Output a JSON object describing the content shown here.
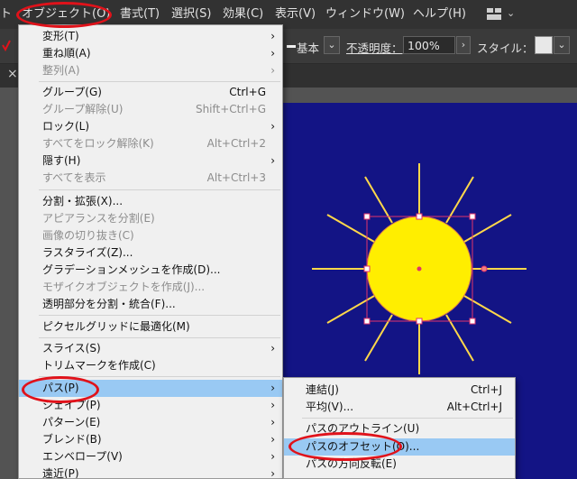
{
  "menubar": {
    "partial": "ト",
    "items": [
      "オブジェクト(O)",
      "書式(T)",
      "選択(S)",
      "効果(C)",
      "表示(V)",
      "ウィンドウ(W)",
      "ヘルプ(H)"
    ],
    "workspace_icon": "grid-layout-icon",
    "workspace_chevron": "⌄"
  },
  "controlbar": {
    "stroke_style_label": "基本",
    "opacity_label": "不透明度：",
    "opacity_value": "100%",
    "style_label": "スタイル：",
    "chevron": "⌄",
    "arrow": "›"
  },
  "tab": {
    "close": "×"
  },
  "object_menu": {
    "items": [
      {
        "label": "変形(T)",
        "shortcut": "",
        "submenu": true,
        "disabled": false
      },
      {
        "label": "重ね順(A)",
        "shortcut": "",
        "submenu": true,
        "disabled": false
      },
      {
        "label": "整列(A)",
        "shortcut": "",
        "submenu": true,
        "disabled": true
      },
      {
        "label": "グループ(G)",
        "shortcut": "Ctrl+G",
        "submenu": false,
        "disabled": false
      },
      {
        "label": "グループ解除(U)",
        "shortcut": "Shift+Ctrl+G",
        "submenu": false,
        "disabled": true
      },
      {
        "label": "ロック(L)",
        "shortcut": "",
        "submenu": true,
        "disabled": false
      },
      {
        "label": "すべてをロック解除(K)",
        "shortcut": "Alt+Ctrl+2",
        "submenu": false,
        "disabled": true
      },
      {
        "label": "隠す(H)",
        "shortcut": "",
        "submenu": true,
        "disabled": false
      },
      {
        "label": "すべてを表示",
        "shortcut": "Alt+Ctrl+3",
        "submenu": false,
        "disabled": true
      },
      {
        "label": "分割・拡張(X)...",
        "shortcut": "",
        "submenu": false,
        "disabled": false
      },
      {
        "label": "アピアランスを分割(E)",
        "shortcut": "",
        "submenu": false,
        "disabled": true
      },
      {
        "label": "画像の切り抜き(C)",
        "shortcut": "",
        "submenu": false,
        "disabled": true
      },
      {
        "label": "ラスタライズ(Z)...",
        "shortcut": "",
        "submenu": false,
        "disabled": false
      },
      {
        "label": "グラデーションメッシュを作成(D)...",
        "shortcut": "",
        "submenu": false,
        "disabled": false
      },
      {
        "label": "モザイクオブジェクトを作成(J)...",
        "shortcut": "",
        "submenu": false,
        "disabled": true
      },
      {
        "label": "透明部分を分割・統合(F)...",
        "shortcut": "",
        "submenu": false,
        "disabled": false
      },
      {
        "label": "ピクセルグリッドに最適化(M)",
        "shortcut": "",
        "submenu": false,
        "disabled": false
      },
      {
        "label": "スライス(S)",
        "shortcut": "",
        "submenu": true,
        "disabled": false
      },
      {
        "label": "トリムマークを作成(C)",
        "shortcut": "",
        "submenu": false,
        "disabled": false
      },
      {
        "label": "パス(P)",
        "shortcut": "",
        "submenu": true,
        "disabled": false,
        "highlighted": true
      },
      {
        "label": "シェイプ(P)",
        "shortcut": "",
        "submenu": true,
        "disabled": false
      },
      {
        "label": "パターン(E)",
        "shortcut": "",
        "submenu": true,
        "disabled": false
      },
      {
        "label": "ブレンド(B)",
        "shortcut": "",
        "submenu": true,
        "disabled": false
      },
      {
        "label": "エンベロープ(V)",
        "shortcut": "",
        "submenu": true,
        "disabled": false
      },
      {
        "label": "遠近(P)",
        "shortcut": "",
        "submenu": true,
        "disabled": false
      }
    ],
    "arrow": "›"
  },
  "path_submenu": {
    "items": [
      {
        "label": "連結(J)",
        "shortcut": "Ctrl+J"
      },
      {
        "label": "平均(V)...",
        "shortcut": "Alt+Ctrl+J"
      },
      {
        "label": "パスのアウトライン(U)",
        "shortcut": ""
      },
      {
        "label": "パスのオフセット(O)...",
        "shortcut": "",
        "highlighted": true
      },
      {
        "label": "パスの方向反転(E)",
        "shortcut": ""
      }
    ]
  },
  "colors": {
    "artboard_bg": "#131485",
    "sun_fill": "#ffee00",
    "ray_color": "#ffd84a",
    "selection": "#e0336a",
    "highlight": "#99c9f3",
    "annotation": "#e0121a"
  }
}
